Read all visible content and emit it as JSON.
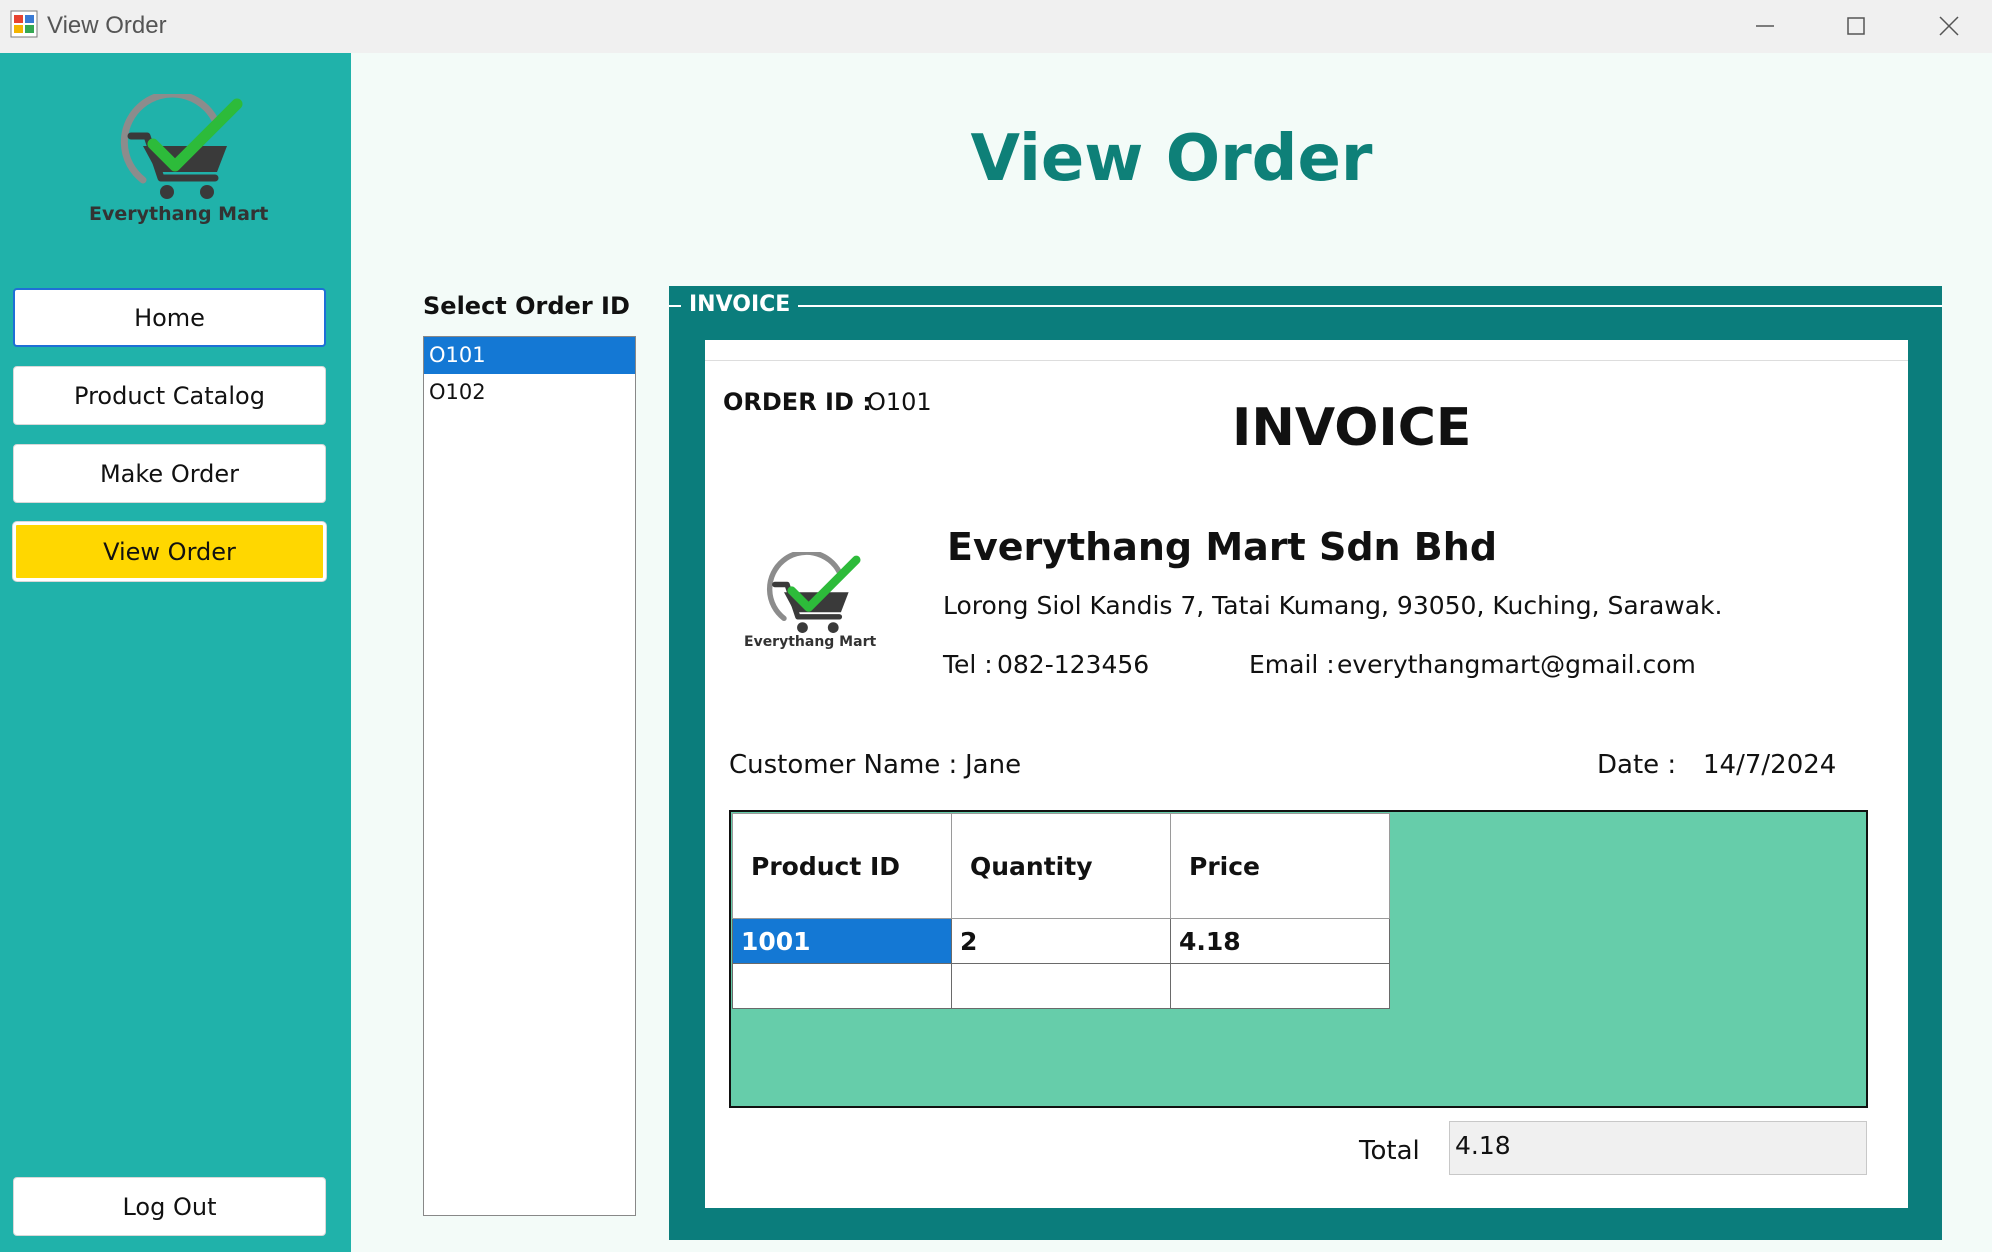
{
  "window": {
    "title": "View Order"
  },
  "sidebar": {
    "logo_text": "Everythang Mart",
    "nav": [
      {
        "label": "Home"
      },
      {
        "label": "Product Catalog"
      },
      {
        "label": "Make Order"
      },
      {
        "label": "View Order",
        "active": true
      }
    ],
    "logout_label": "Log Out"
  },
  "main": {
    "heading": "View Order",
    "select_label": "Select Order ID",
    "order_ids": [
      "O101",
      "O102"
    ],
    "selected_order_id": "O101"
  },
  "invoice": {
    "group_caption": "INVOICE",
    "order_id_label": "ORDER ID :",
    "order_id_value": "O101",
    "title": "INVOICE",
    "logo_text": "Everythang Mart",
    "company_name": "Everythang Mart Sdn Bhd",
    "address": "Lorong Siol Kandis 7, Tatai Kumang, 93050, Kuching, Sarawak.",
    "tel_label": "Tel :",
    "tel_value": "082-123456",
    "email_label": "Email :",
    "email_value": "everythangmart@gmail.com",
    "customer_label": "Customer Name :",
    "customer_value": "Jane",
    "date_label": "Date :",
    "date_value": "14/7/2024",
    "table": {
      "headers": [
        "Product ID",
        "Quantity",
        "Price"
      ],
      "rows": [
        [
          "1001",
          "2",
          "4.18"
        ],
        [
          "",
          "",
          ""
        ]
      ]
    },
    "total_label": "Total",
    "total_value": "4.18"
  },
  "colors": {
    "sidebar": "#20b2aa",
    "heading": "#0e8078",
    "frame": "#0b7d7c",
    "grid_background": "#66cdaa",
    "active_nav": "#ffd700",
    "selection": "#1478d4"
  }
}
